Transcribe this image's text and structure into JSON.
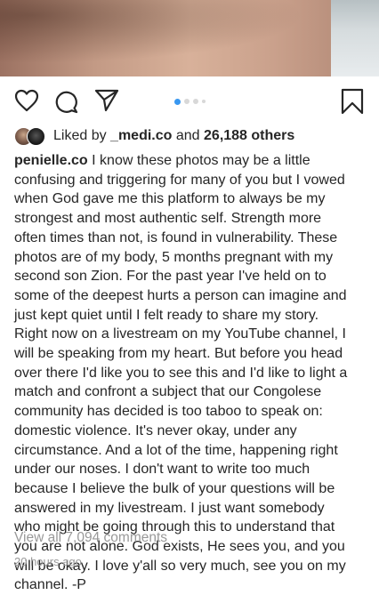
{
  "post": {
    "photo_label": "post-photo",
    "carousel": {
      "count": 4,
      "active_index": 0
    }
  },
  "actions": {
    "like_icon": "heart-icon",
    "comment_icon": "comment-icon",
    "share_icon": "paper-plane-icon",
    "save_icon": "bookmark-icon"
  },
  "likes": {
    "prefix": "Liked by",
    "user": "_medi.co",
    "conjunction": "and",
    "count": "26,188 others"
  },
  "caption": {
    "username": "penielle.co",
    "text": "I know these photos may be a little\nconfusing and triggering for many of you but I vowed\nwhen God gave me this platform to always be my\nstrongest and most authentic self. Strength more\noften times than not, is found in vulnerability. These\nphotos are of my body, 5 months pregnant with my\nsecond son Zion. For the past year I've held on to\nsome of the deepest hurts a person can imagine and\njust kept quiet until I felt ready to share my story.\nRight now on a livestream on my YouTube channel, I\nwill be speaking from my heart. But before you head\nover there I'd like you to see this and I'd like to light a\nmatch and confront a subject that our Congolese\ncommunity has decided is too taboo to speak on:\ndomestic violence. It's never okay, under any\ncircumstance. And a lot of the time, happening right\nunder our noses. I don't want to write too much\nbecause I believe the bulk of your questions will be\nanswered in my livestream. I just want somebody\nwho might be going through this to understand that\nyou are not alone. God exists, He sees you, and you\nwill be okay. I love y'all so very much, see you on my\nchannel. -P"
  },
  "comments": {
    "view_all": "View all 7,094 comments"
  },
  "timestamp": "20 hours ago",
  "colors": {
    "text": "#262626",
    "muted": "#999999",
    "accent": "#3897f0"
  }
}
